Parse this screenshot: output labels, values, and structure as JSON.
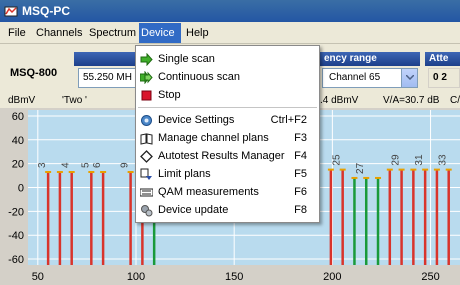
{
  "window": {
    "title": "MSQ-PC"
  },
  "menubar": {
    "items": [
      {
        "label": "File"
      },
      {
        "label": "Channels"
      },
      {
        "label": "Spectrum"
      },
      {
        "label": "Device"
      },
      {
        "label": "Help"
      }
    ],
    "active": "Device"
  },
  "controls": {
    "device_name": "MSQ-800",
    "frequency_value": "55.250 MH",
    "frequency_range_header": "ency range",
    "channel_value": "Channel 65",
    "attenuation_header": "Atte",
    "attenuation_value": "0  2"
  },
  "infobar": {
    "unit": "dBmV",
    "trace_label": "'Two  '",
    "level": ".4 dBmV",
    "va": "V/A=30.7 dB",
    "ca": "C/"
  },
  "device_menu": {
    "items": [
      {
        "label": "Single scan",
        "shortcut": "",
        "icon": "green-arrow-icon"
      },
      {
        "label": "Continuous scan",
        "shortcut": "",
        "icon": "double-green-arrow-icon"
      },
      {
        "label": "Stop",
        "shortcut": "",
        "icon": "red-stop-square-icon"
      },
      {
        "label": "Device Settings",
        "shortcut": "Ctrl+F2",
        "icon": "settings-gear-icon"
      },
      {
        "label": "Manage channel plans",
        "shortcut": "F3",
        "icon": "book-icon"
      },
      {
        "label": "Autotest Results Manager",
        "shortcut": "F4",
        "icon": "diamond-icon"
      },
      {
        "label": "Limit plans",
        "shortcut": "F5",
        "icon": "limit-plan-icon"
      },
      {
        "label": "QAM measurements",
        "shortcut": "F6",
        "icon": "qam-icon"
      },
      {
        "label": "Device update",
        "shortcut": "F8",
        "icon": "gears-icon"
      }
    ]
  },
  "chart_data": {
    "type": "bar",
    "y_unit": "dBmV",
    "ylim": [
      -65,
      65
    ],
    "xlim": [
      45,
      265
    ],
    "y_ticks": [
      60,
      40,
      20,
      0,
      -20,
      -40,
      -60
    ],
    "x_ticks": [
      50,
      100,
      150,
      200,
      250
    ],
    "grid": true,
    "background_color": "#b9dbee",
    "colors": {
      "video": "#d9342b",
      "digital": "#1a9a3a",
      "marker": "#e8a000"
    },
    "bars": [
      {
        "x": 55.25,
        "value": 13,
        "color": "video",
        "label": "3"
      },
      {
        "x": 61.25,
        "value": 13,
        "color": "video",
        "label": ""
      },
      {
        "x": 67.25,
        "value": 13,
        "color": "video",
        "label": "4"
      },
      {
        "x": 77.25,
        "value": 13,
        "color": "video",
        "label": "5"
      },
      {
        "x": 83.25,
        "value": 13,
        "color": "video",
        "label": "6"
      },
      {
        "x": 97.25,
        "value": 13,
        "color": "video",
        "label": "9"
      },
      {
        "x": 103.25,
        "value": 13,
        "color": "video",
        "label": ""
      },
      {
        "x": 109.25,
        "value": 8,
        "color": "digital",
        "label": ""
      },
      {
        "x": 199.25,
        "value": 15,
        "color": "video",
        "label": ""
      },
      {
        "x": 205.25,
        "value": 15,
        "color": "video",
        "label": "25"
      },
      {
        "x": 211.25,
        "value": 8,
        "color": "digital",
        "label": ""
      },
      {
        "x": 217.25,
        "value": 8,
        "color": "digital",
        "label": "27"
      },
      {
        "x": 223.25,
        "value": 8,
        "color": "digital",
        "label": ""
      },
      {
        "x": 229.25,
        "value": 15,
        "color": "video",
        "label": ""
      },
      {
        "x": 235.25,
        "value": 15,
        "color": "video",
        "label": "29"
      },
      {
        "x": 241.25,
        "value": 15,
        "color": "video",
        "label": ""
      },
      {
        "x": 247.25,
        "value": 15,
        "color": "video",
        "label": "31"
      },
      {
        "x": 253.25,
        "value": 15,
        "color": "video",
        "label": ""
      },
      {
        "x": 259.25,
        "value": 15,
        "color": "video",
        "label": "33"
      }
    ]
  }
}
